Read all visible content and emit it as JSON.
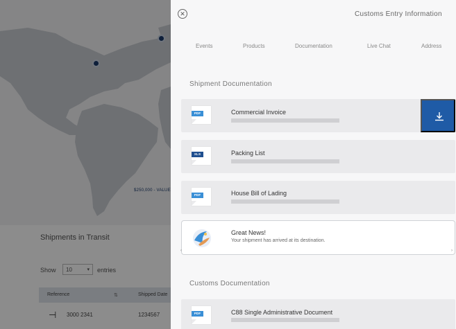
{
  "background": {
    "map_scale": "$250,000 - VALUE",
    "shipments_title": "Shipments in Transit",
    "show_label": "Show",
    "show_value": "10",
    "entries_label": "entries",
    "table": {
      "columns": [
        "Reference",
        "Shipped Date"
      ],
      "rows": [
        {
          "reference": "3000 2341",
          "shipped": "1234567"
        }
      ]
    }
  },
  "drawer": {
    "close_icon": "close-circle-icon",
    "title": "Customs Entry Information",
    "tabs": [
      "Events",
      "Products",
      "Documentation",
      "Live Chat",
      "Address"
    ],
    "shipment_section": "Shipment Documentation",
    "customs_section": "Customs Documentation",
    "documents": [
      {
        "name": "Commercial Invoice",
        "type": "PDF",
        "color": "#3a8fd6"
      },
      {
        "name": "Packing List",
        "type": "XLS",
        "color": "#1f4f8f"
      },
      {
        "name": "House Bill of Lading",
        "type": "PDF",
        "color": "#3a8fd6"
      }
    ],
    "customs_documents": [
      {
        "name": "C88 Single Administrative Document",
        "type": "PDF",
        "color": "#3a8fd6"
      }
    ],
    "download_icon": "download-icon",
    "news": {
      "title": "Great News!",
      "text": "Your shipment has arrived at its destination."
    },
    "accent_color": "#1f5ba6"
  }
}
